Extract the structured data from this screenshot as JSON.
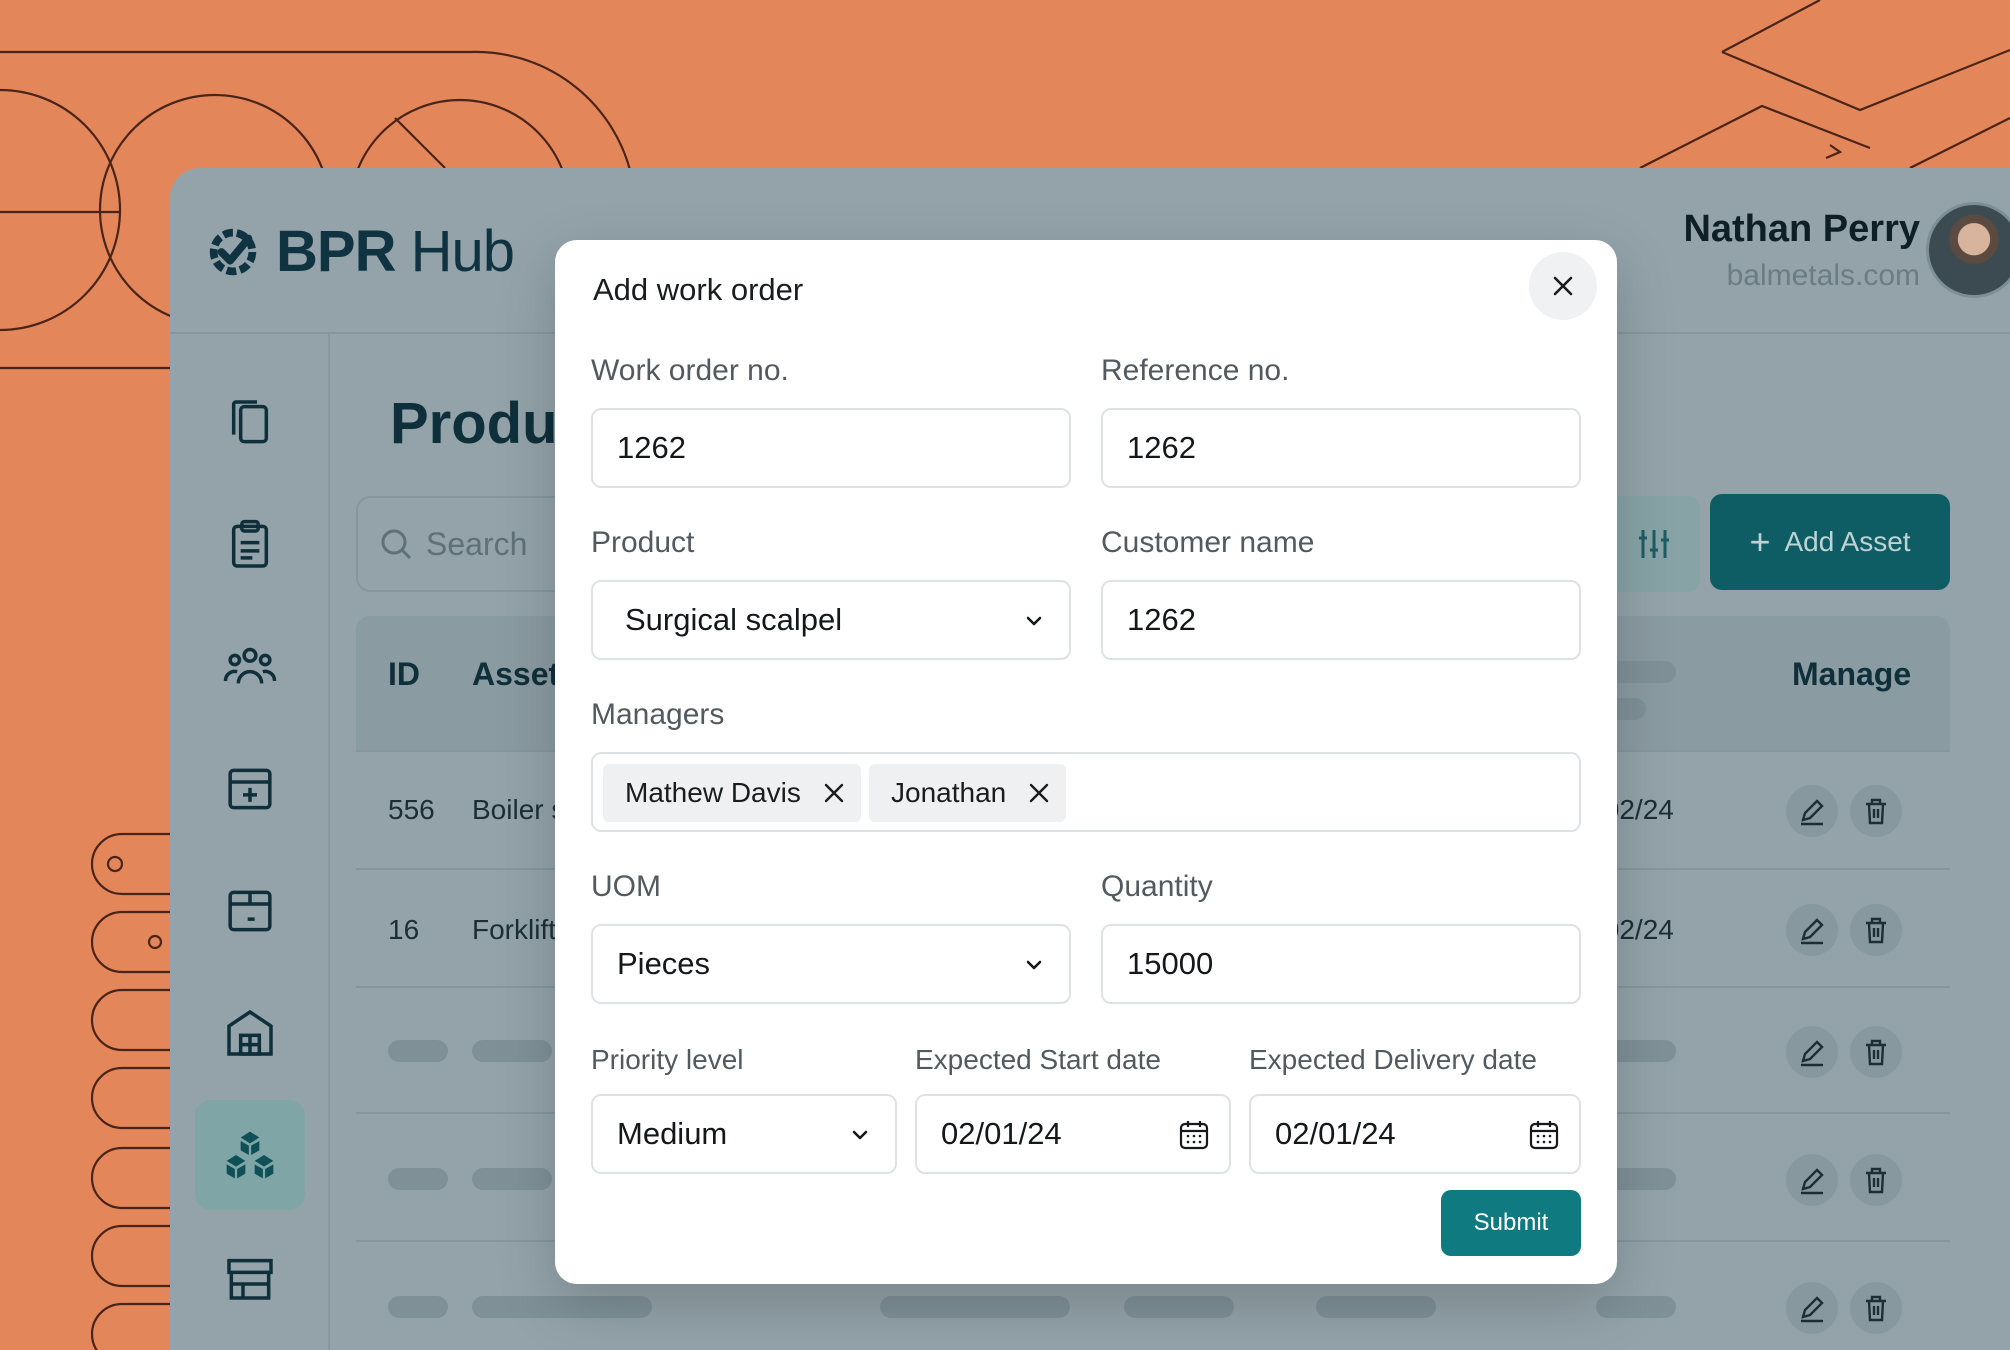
{
  "header": {
    "logo_bold": "BPR",
    "logo_light": "Hub",
    "user_name": "Nathan Perry",
    "user_email": "balmetals.com"
  },
  "sidebar": {
    "items": [
      {
        "icon": "documents-icon"
      },
      {
        "icon": "clipboard-icon"
      },
      {
        "icon": "users-icon"
      },
      {
        "icon": "box-add-icon"
      },
      {
        "icon": "box-remove-icon"
      },
      {
        "icon": "warehouse-icon"
      },
      {
        "icon": "products-icon",
        "active": true
      },
      {
        "icon": "store-icon"
      }
    ]
  },
  "page": {
    "title": "Produc",
    "search_placeholder": "Search",
    "add_asset_label": "Add Asset"
  },
  "table": {
    "headers": {
      "id": "ID",
      "asset": "Asset",
      "manage": "Manage"
    },
    "rows": [
      {
        "id": "556",
        "asset": "Boiler s",
        "date": "/02/24"
      },
      {
        "id": "16",
        "asset": "Forklift",
        "date": "/02/24"
      }
    ]
  },
  "modal": {
    "title": "Add work order",
    "work_order_label": "Work order no.",
    "work_order_value": "1262",
    "reference_label": "Reference no.",
    "reference_value": "1262",
    "product_label": "Product",
    "product_value": "Surgical scalpel",
    "customer_label": "Customer name",
    "customer_value": "1262",
    "managers_label": "Managers",
    "managers": [
      "Mathew Davis",
      "Jonathan"
    ],
    "uom_label": "UOM",
    "uom_value": "Pieces",
    "quantity_label": "Quantity",
    "quantity_value": "15000",
    "priority_label": "Priority level",
    "priority_value": "Medium",
    "start_label": "Expected Start date",
    "start_value": "02/01/24",
    "delivery_label": "Expected Delivery date",
    "delivery_value": "02/01/24",
    "submit_label": "Submit"
  },
  "colors": {
    "background": "#e3875b",
    "overlay": "#93a3a9",
    "accent": "#0f7a80"
  }
}
